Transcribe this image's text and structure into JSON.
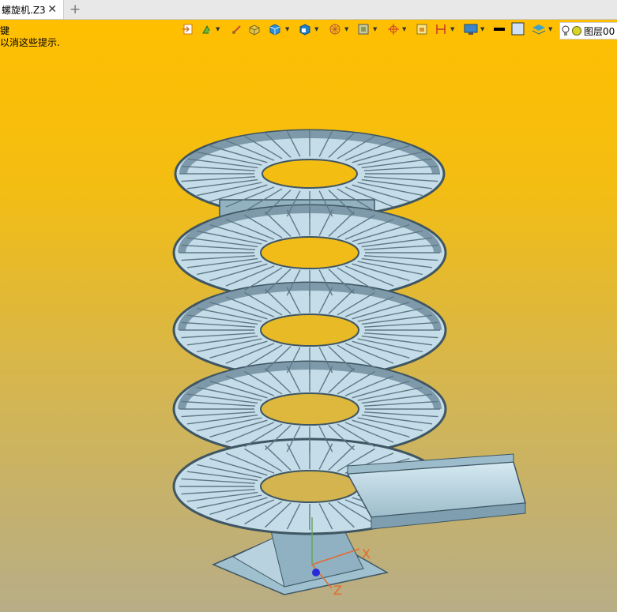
{
  "tab": {
    "title": "螺旋机.Z3",
    "close_glyph": "✕",
    "add_glyph": "+"
  },
  "hints": {
    "line1": "键",
    "line2": "以消这些提示."
  },
  "toolbar": {
    "items": [
      "import-icon",
      "paint-icon",
      "brush-icon",
      "box-shade-icon",
      "cube-icon",
      "view-cube-icon",
      "wireframe-icon",
      "frame-icon",
      "origin-icon",
      "page-icon",
      "dimension-icon",
      "monitor-icon",
      "line-color-icon",
      "fill-color-icon",
      "layers-icon"
    ],
    "layer": {
      "label": "图层00"
    }
  },
  "colors": {
    "accent_top": "#ffbf00",
    "accent_bottom": "#b7ad87",
    "model": "#9fbfce",
    "model_dark": "#57707e"
  },
  "axis": {
    "x_label": "X",
    "z_label": "Z"
  }
}
